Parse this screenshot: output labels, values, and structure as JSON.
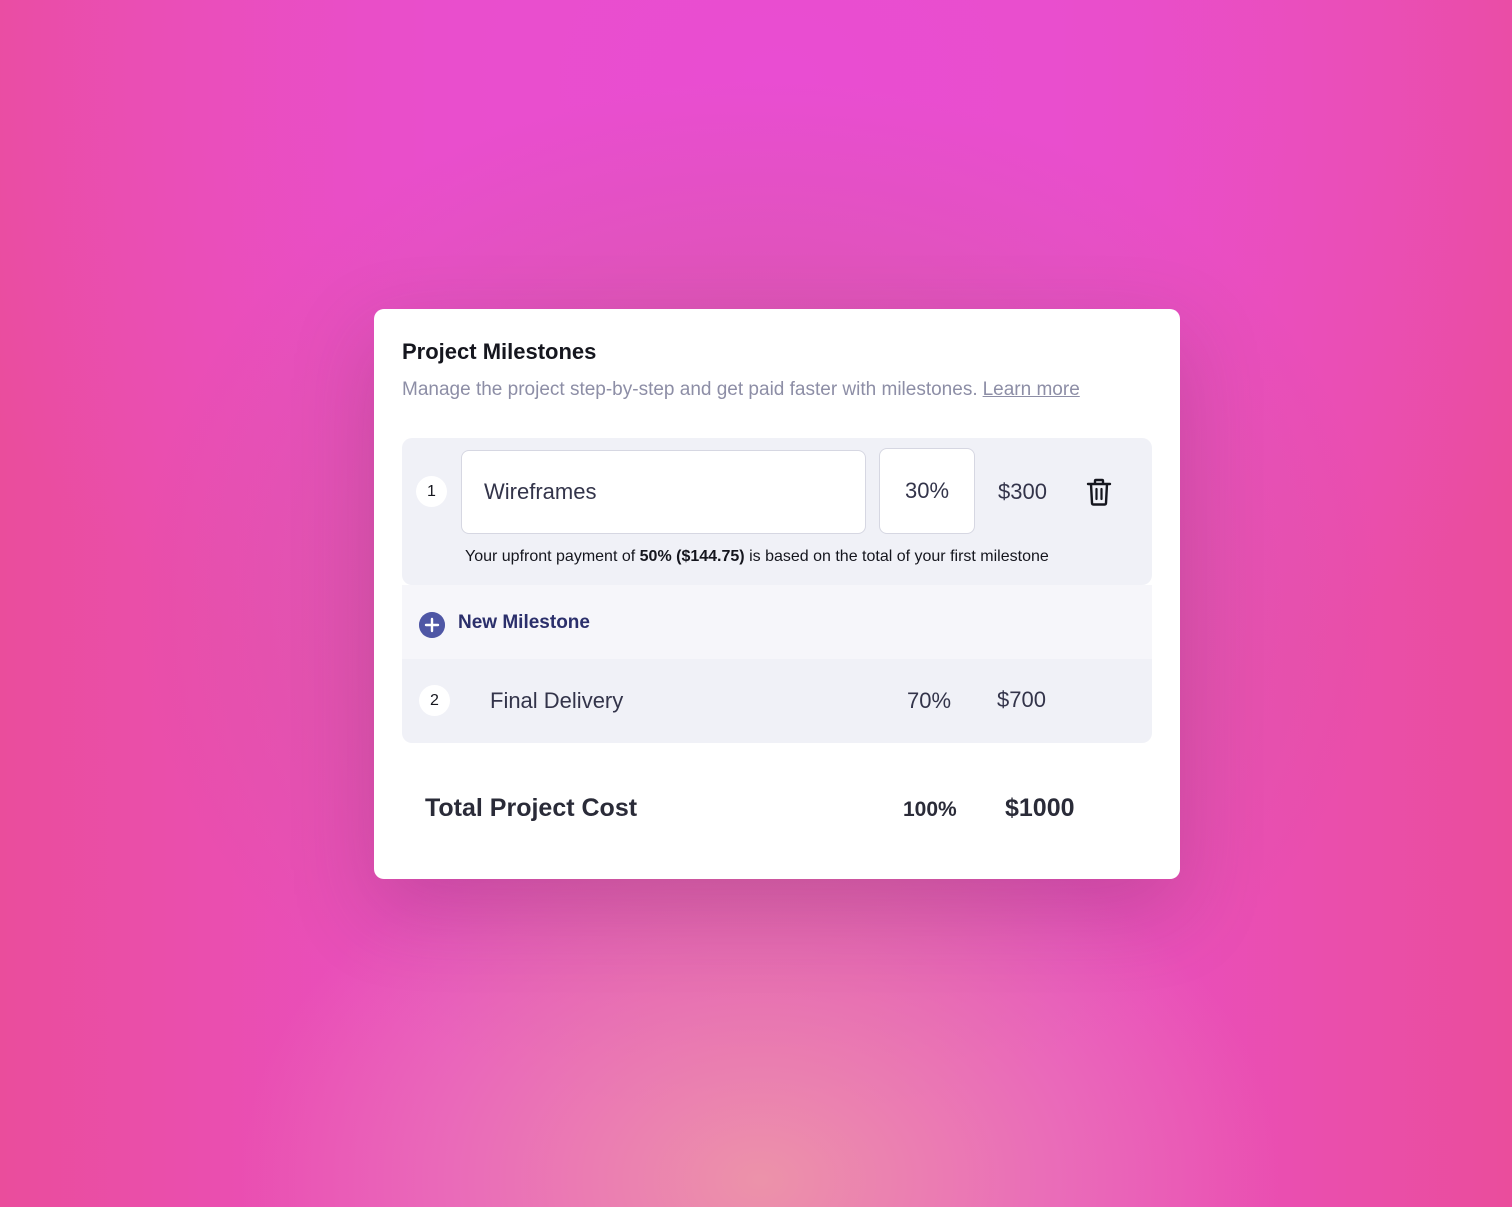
{
  "header": {
    "title": "Project Milestones",
    "subtitle": "Manage the project step-by-step and get paid faster with milestones.",
    "learn_more": "Learn more"
  },
  "milestones": [
    {
      "number": "1",
      "name": "Wireframes",
      "percent": "30%",
      "amount": "$300",
      "delete_icon": "trash-icon"
    },
    {
      "number": "2",
      "name": "Final Delivery",
      "percent": "70%",
      "amount": "$700"
    }
  ],
  "upfront_note": {
    "prefix": "Your upfront payment of",
    "highlight": "50% ($144.75)",
    "suffix": "is based on the total of your first milestone"
  },
  "new_milestone": {
    "label": "New Milestone",
    "icon": "plus-circle-icon"
  },
  "total": {
    "label": "Total Project Cost",
    "percent": "100%",
    "amount": "$1000"
  },
  "colors": {
    "accent": "#4f57a5",
    "accent_text": "#2b2f6b",
    "background_pink": "#e94fc4",
    "row_background": "#f0f1f7"
  }
}
